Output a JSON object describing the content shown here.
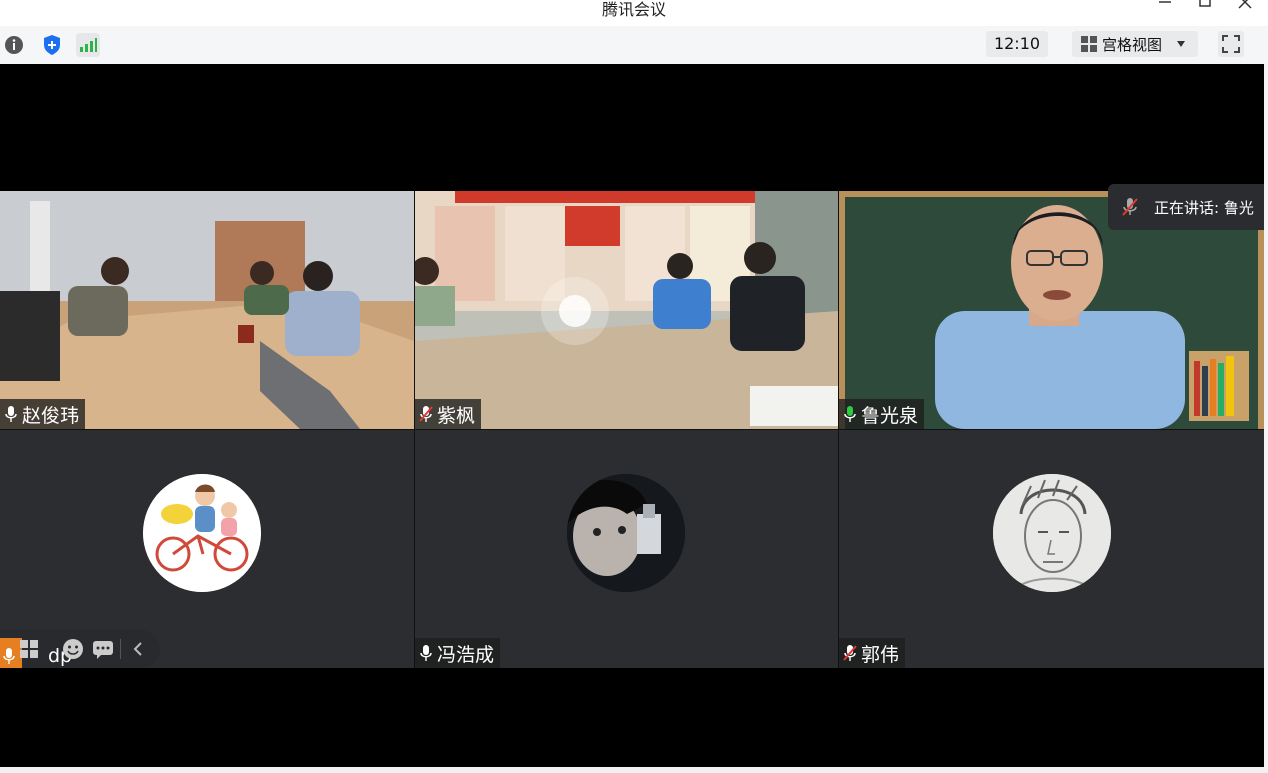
{
  "window": {
    "title": "腾讯会议",
    "minimize_icon": "minimize-icon",
    "maximize_icon": "maximize-icon",
    "close_icon": "close-icon"
  },
  "toolbar": {
    "info_icon": "info-icon",
    "security_icon": "shield-icon",
    "signal_icon": "signal-bars-icon",
    "meeting_time": "12:10",
    "view_label": "宫格视图",
    "view_icon": "grid-icon",
    "fullscreen_icon": "fullscreen-icon"
  },
  "speaking_banner": {
    "label": "正在讲话: 鲁光",
    "icon": "mic-muted-icon"
  },
  "participants": [
    {
      "name": "赵俊玮",
      "mic": "on",
      "type": "video"
    },
    {
      "name": "紫枫",
      "mic": "muted",
      "type": "video"
    },
    {
      "name": "鲁光泉",
      "mic": "speaking",
      "type": "video"
    },
    {
      "name": "dp",
      "mic": "on",
      "type": "avatar"
    },
    {
      "name": "冯浩成",
      "mic": "on",
      "type": "avatar"
    },
    {
      "name": "郭伟",
      "mic": "muted",
      "type": "avatar"
    }
  ],
  "colors": {
    "stage_bg": "#000000",
    "tile_bg": "#2b2d30",
    "mic_active": "#2ecc40",
    "mic_muted": "#e53935",
    "shield_blue": "#1e6ff0",
    "signal_green": "#2db34a"
  }
}
